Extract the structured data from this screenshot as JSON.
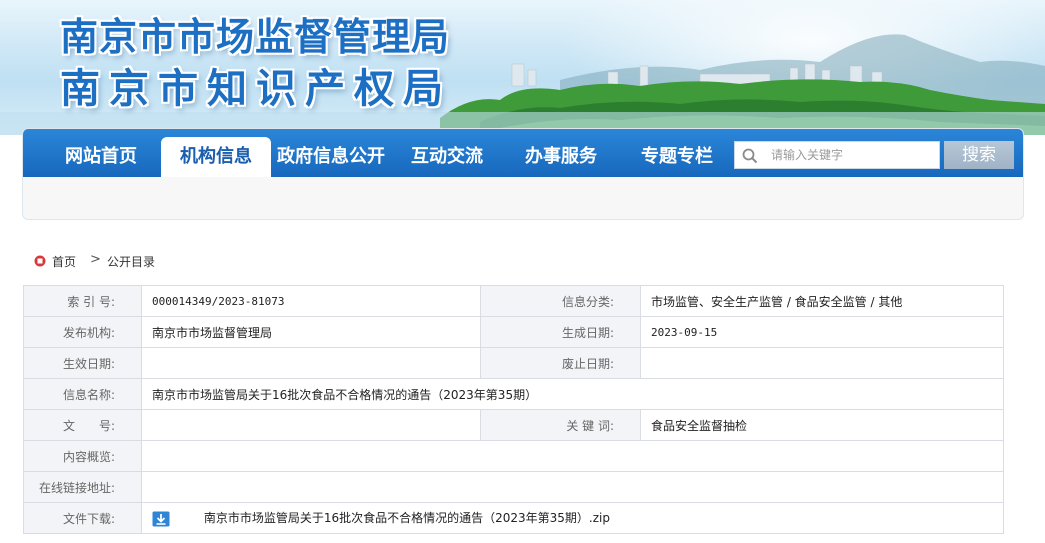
{
  "header": {
    "title_line1": "南京市市场监督管理局",
    "title_line2": "南京市知识产权局"
  },
  "nav": {
    "items": [
      {
        "label": "网站首页",
        "active": false
      },
      {
        "label": "机构信息",
        "active": true
      },
      {
        "label": "政府信息公开",
        "active": false
      },
      {
        "label": "互动交流",
        "active": false
      },
      {
        "label": "办事服务",
        "active": false
      },
      {
        "label": "专题专栏",
        "active": false
      }
    ],
    "search_placeholder": "请输入关键字",
    "search_button": "搜索"
  },
  "breadcrumb": {
    "home": "首页",
    "separator": ">",
    "current": "公开目录"
  },
  "info": {
    "index_no_label": "索 引 号:",
    "index_no": "000014349/2023-81073",
    "category_label": "信息分类:",
    "category": "市场监管、安全生产监管 / 食品安全监管 / 其他",
    "publisher_label": "发布机构:",
    "publisher": "南京市市场监督管理局",
    "created_label": "生成日期:",
    "created": "2023-09-15",
    "effective_label": "生效日期:",
    "effective": "",
    "abolished_label": "废止日期:",
    "abolished": "",
    "name_label": "信息名称:",
    "name": "南京市市场监管局关于16批次食品不合格情况的通告（2023年第35期）",
    "doc_no_label": "文　　号:",
    "doc_no": "",
    "keywords_label": "关 键 词:",
    "keywords": "食品安全监督抽检",
    "summary_label": "内容概览:",
    "summary": "",
    "online_link_label": "在线链接地址:",
    "online_link": "",
    "download_label": "文件下载:",
    "download_file": "南京市市场监管局关于16批次食品不合格情况的通告（2023年第35期）.zip"
  },
  "colors": {
    "nav_blue": "#1768bd",
    "title_blue": "#1d6fc4",
    "label_bg": "#f2f4f7"
  }
}
